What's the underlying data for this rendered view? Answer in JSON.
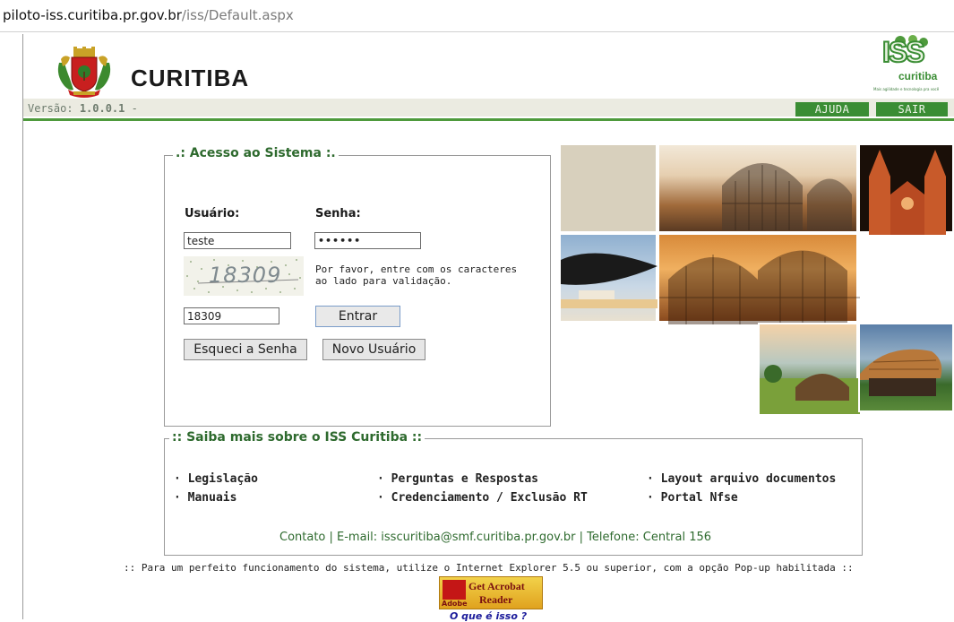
{
  "browser": {
    "url_host": "piloto-iss.curitiba.pr.gov.br",
    "url_path": "/iss/Default.aspx"
  },
  "header": {
    "city_name": "CURITIBA",
    "version_prefix": "Versão:",
    "version_value": "1.0.0.1",
    "version_suffix": "-",
    "iss_logo_text": "ISS",
    "iss_logo_city": "curitiba",
    "iss_logo_tagline": "Mais agilidade e tecnologia pra você",
    "help_label": "AJUDA",
    "exit_label": "SAIR"
  },
  "login": {
    "legend": ".: Acesso ao Sistema :.",
    "user_label": "Usuário:",
    "password_label": "Senha:",
    "user_value": "teste",
    "password_value": "••••••",
    "captcha_text": "18309",
    "captcha_help_line1": "Por favor, entre com os caracteres",
    "captcha_help_line2": "ao lado para validação.",
    "captcha_value": "18309",
    "enter_label": "Entrar",
    "forgot_label": "Esqueci a Senha",
    "new_user_label": "Novo Usuário"
  },
  "info": {
    "legend": ":: Saiba mais sobre o ISS Curitiba ::",
    "links": [
      "· Legislação",
      "· Perguntas e Respostas",
      "· Layout arquivo documentos",
      "· Manuais",
      "· Credenciamento / Exclusão RT",
      "· Portal Nfse"
    ],
    "contact": "Contato | E-mail: isscuritiba@smf.curitiba.pr.gov.br | Telefone: Central 156"
  },
  "footer": {
    "note": ":: Para um perfeito funcionamento do sistema, utilize o Internet Explorer 5.5 ou superior, com a opção Pop-up habilitada ::",
    "acrobat_line1": "Get Acrobat",
    "acrobat_line2": "Reader",
    "acrobat_brand": "Adobe",
    "what_is_this": "O que é isso ?"
  },
  "colors": {
    "accent_green": "#3a8d34",
    "legend_green": "#2e6a2e"
  }
}
